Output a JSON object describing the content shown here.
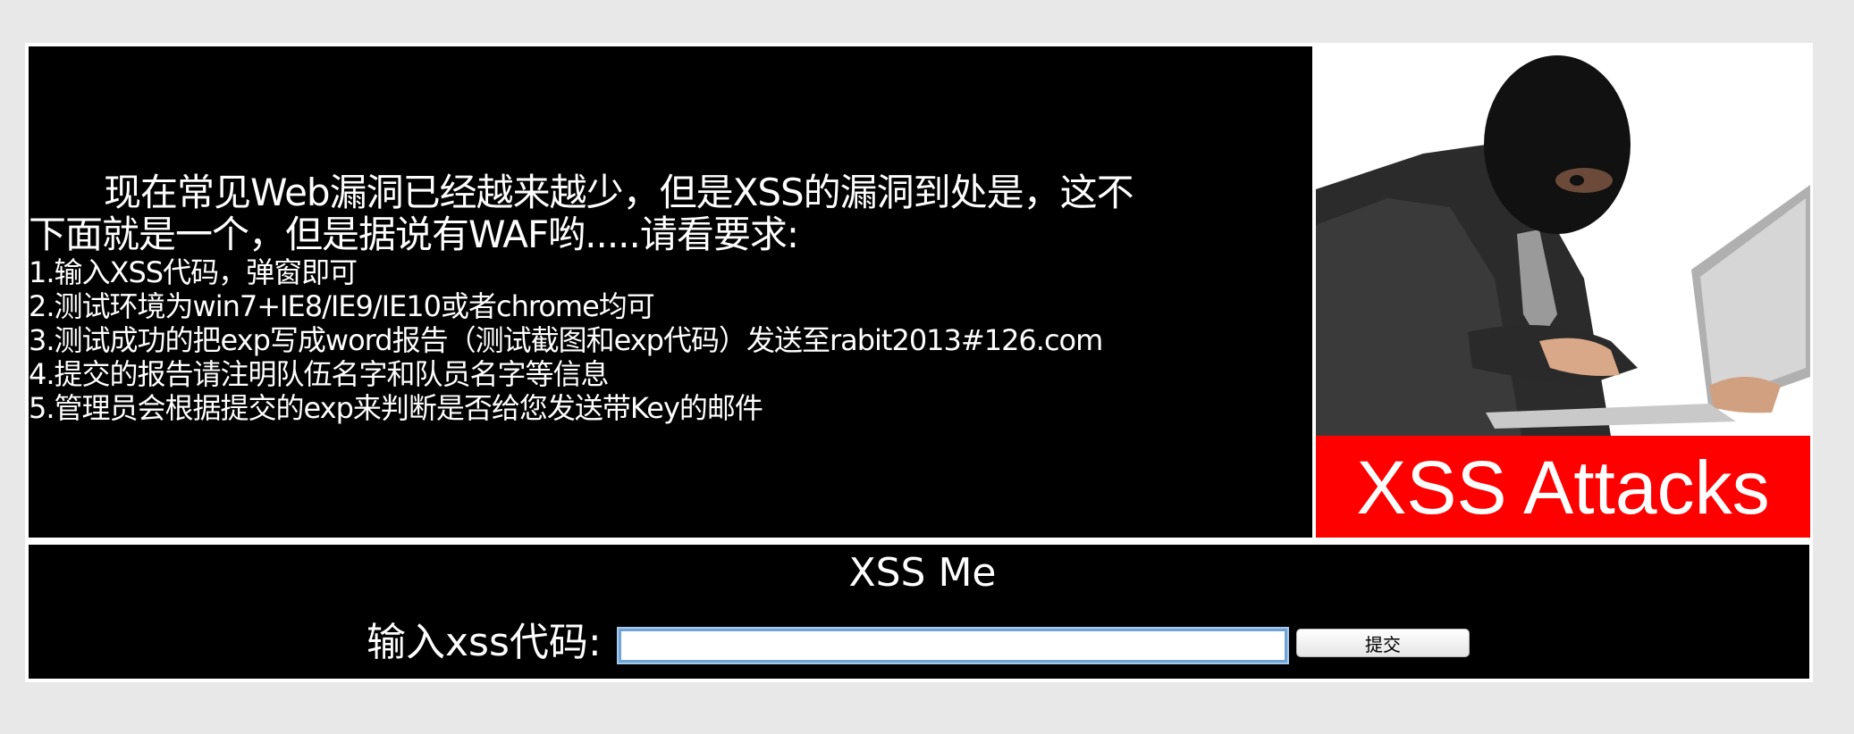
{
  "intro": {
    "line1": "现在常见Web漏洞已经越来越少，但是XSS的漏洞到处是，这不",
    "line2": "下面就是一个，但是据说有WAF哟.....请看要求:"
  },
  "requirements": [
    "1.输入XSS代码，弹窗即可",
    "2.测试环境为win7+IE8/IE9/IE10或者chrome均可",
    "3.测试成功的把exp写成word报告（测试截图和exp代码）发送至rabit2013#126.com",
    "4.提交的报告请注明队伍名字和队员名字等信息",
    "5.管理员会根据提交的exp来判断是否给您发送带Key的邮件"
  ],
  "image": {
    "banner_text": "XSS Attacks",
    "banner_color": "#ff0000"
  },
  "form": {
    "title": "XSS Me",
    "label": "输入xss代码:",
    "input_value": "",
    "submit_label": "提交"
  },
  "colors": {
    "page_bg": "#e8e8e8",
    "panel_bg": "#000000",
    "text": "#ffffff"
  }
}
